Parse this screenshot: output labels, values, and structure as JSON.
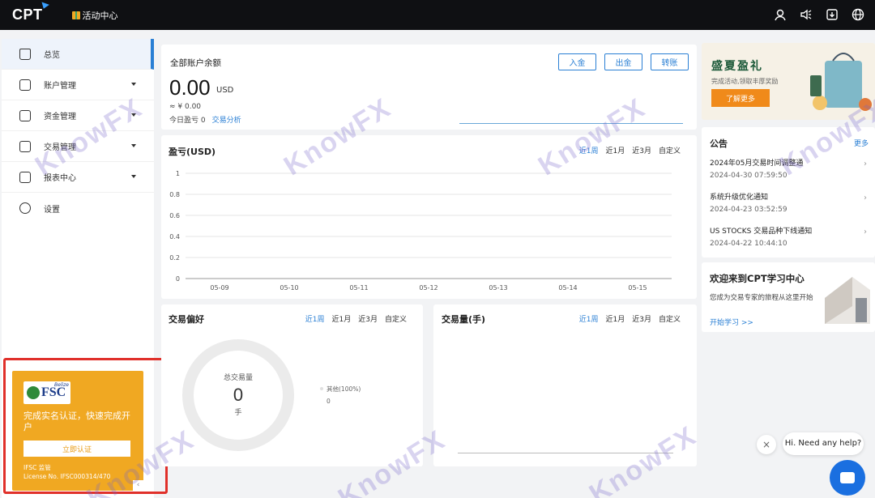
{
  "header": {
    "logo": "CPT",
    "activity": "活动中心",
    "icons": [
      "user-icon",
      "speaker-icon",
      "download-icon",
      "globe-icon"
    ]
  },
  "sidebar": {
    "items": [
      {
        "label": "总览",
        "icon": "home-icon"
      },
      {
        "label": "账户管理",
        "icon": "account-icon"
      },
      {
        "label": "资金管理",
        "icon": "wallet-icon"
      },
      {
        "label": "交易管理",
        "icon": "trade-icon"
      },
      {
        "label": "报表中心",
        "icon": "report-icon"
      },
      {
        "label": "设置",
        "icon": "gear-icon"
      }
    ],
    "promo": {
      "logo_text": "FSC",
      "logo_sub": "Belize",
      "title": "完成实名认证，快速完成开户",
      "button": "立即认证",
      "regulator": "IFSC 监管",
      "license": "License No. IFSC000314/470",
      "bg_color": "#f0a822"
    }
  },
  "balance": {
    "title": "全部账户余额",
    "value": "0.00",
    "unit": "USD",
    "approx": "≈ ¥ 0.00",
    "pnl_label": "今日盈亏 0",
    "analysis_link": "交易分析",
    "buttons": {
      "deposit": "入金",
      "withdraw": "出金",
      "transfer": "转账"
    }
  },
  "pnl_chart": {
    "title": "盈亏(USD)",
    "ranges": [
      "近1周",
      "近1月",
      "近3月",
      "自定义"
    ]
  },
  "chart_data": [
    {
      "type": "line",
      "title": "盈亏(USD)",
      "x": [
        "05-09",
        "05-10",
        "05-11",
        "05-12",
        "05-13",
        "05-14",
        "05-15"
      ],
      "y_ticks": [
        "1",
        "0.8",
        "0.6",
        "0.4",
        "0.2",
        "0"
      ],
      "ylim": [
        0,
        1
      ],
      "series": [],
      "grid": true
    },
    {
      "type": "pie",
      "title": "交易偏好",
      "center_label": "总交易量",
      "center_value": "0",
      "center_unit": "手",
      "legend": [
        {
          "name": "其他(100%)",
          "value": "0"
        }
      ]
    }
  ],
  "preference": {
    "title": "交易偏好",
    "ranges": [
      "近1周",
      "近1月",
      "近3月",
      "自定义"
    ],
    "center_label": "总交易量",
    "center_value": "0",
    "center_unit": "手",
    "legend_name": "其他(100%)",
    "legend_value": "0"
  },
  "volume": {
    "title": "交易量(手)",
    "ranges": [
      "近1周",
      "近1月",
      "近3月",
      "自定义"
    ]
  },
  "summer": {
    "title": "盛夏盈礼",
    "subtitle": "完成活动,领取丰厚奖励",
    "button": "了解更多"
  },
  "notices": {
    "title": "公告",
    "more": "更多",
    "items": [
      {
        "title": "2024年05月交易时间调整通",
        "date": "2024-04-30 07:59:50"
      },
      {
        "title": "系统升级优化通知",
        "date": "2024-04-23 03:52:59"
      },
      {
        "title": "US STOCKS 交易品种下线通知",
        "date": "2024-04-22 10:44:10"
      }
    ]
  },
  "learning": {
    "title": "欢迎来到CPT学习中心",
    "desc": "您成为交易专家的旅程从这里开始",
    "link": "开始学习 >>"
  },
  "chat": {
    "bubble": "Hi. Need any help?",
    "close": "×"
  },
  "watermark": "KnowFX"
}
